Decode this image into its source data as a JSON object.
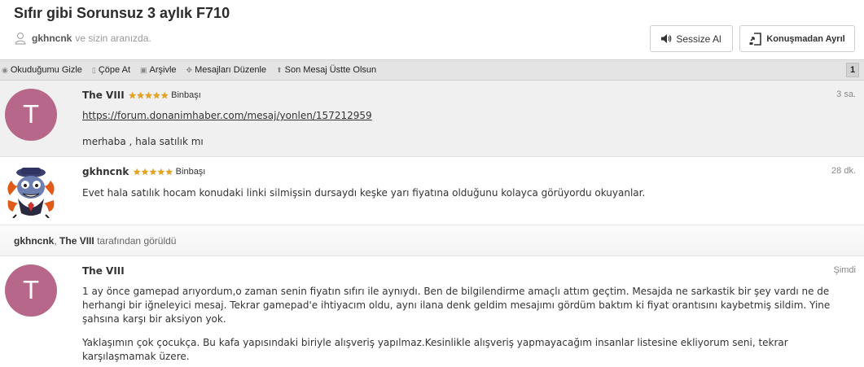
{
  "header": {
    "title": "Sıfır gibi Sorunsuz 3 aylık F710",
    "participants_user": "gkhncnk",
    "participants_suffix": "ve sizin aranızda.",
    "mute_label": "Sessize Al",
    "leave_label": "Konuşmadan Ayrıl"
  },
  "toolbar": {
    "items": [
      {
        "icon": "eye-icon",
        "label": "Okuduğumu Gizle"
      },
      {
        "icon": "trash-icon",
        "label": "Çöpe At"
      },
      {
        "icon": "archive-icon",
        "label": "Arşivle"
      },
      {
        "icon": "move-icon",
        "label": "Mesajları Düzenle"
      },
      {
        "icon": "arrow-up-icon",
        "label": "Son Mesaj Üstte Olsun"
      }
    ],
    "page": "1"
  },
  "messages": [
    {
      "avatar_letter": "T",
      "author": "The VIII",
      "rank": "Binbaşı",
      "time": "3 sa.",
      "link": "https://forum.donanimhaber.com/mesaj/yonlen/157212959",
      "text": "merhaba , hala satılık mı"
    },
    {
      "author": "gkhncnk",
      "rank": "Binbaşı",
      "time": "28 dk.",
      "text": "Evet hala satılık hocam konudaki linki silmişsin dursaydı keşke yarı fiyatına olduğunu kolayca görüyordu okuyanlar."
    },
    {
      "avatar_letter": "T",
      "author": "The VIII",
      "time": "Şimdi",
      "para1": "1 ay önce gamepad arıyordum,o zaman senin fiyatın sıfırı ile aynıydı. Ben de bilgilendirme amaçlı attım geçtim. Mesajda ne sarkastik bir şey vardı ne de herhangi bir iğneleyici mesaj. Tekrar gamepad'e ihtiyacım oldu, aynı ilana denk geldim mesajımı gördüm baktım ki fiyat orantısını kaybetmiş sildim. Yine şahsına karşı bir aksiyon yok.",
      "para2": "Yaklaşımın çok çocukça. Bu kafa yapısındaki biriyle alışveriş yapılmaz.Kesinlikle alışveriş yapmayacağım insanlar listesine ekliyorum seni, tekrar karşılaşmamak üzere."
    }
  ],
  "seen": {
    "user1": "gkhncnk",
    "separator": ",",
    "user2": "The VIII",
    "suffix": "tarafından görüldü"
  },
  "colors": {
    "avatar_bg": "#b7688a",
    "star": "#e8a317",
    "toolbar_bg": "#e4e4e4"
  }
}
